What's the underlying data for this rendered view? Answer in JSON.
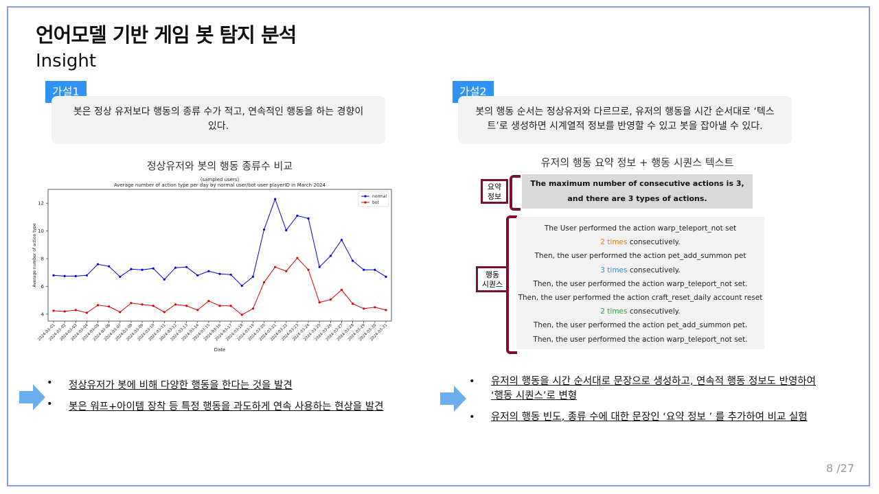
{
  "title": "언어모델 기반 게임 봇 탐지 분석",
  "subtitle": "Insight",
  "left": {
    "tag": "가설1",
    "hypothesis_line1": "봇은 정상 유저보다 행동의 종류 수가 적고, 연속적인 행동을 하는 경향이",
    "hypothesis_line2": "있다.",
    "section_title": "정상유저와 봇의 행동 종류수 비교",
    "bullets": [
      "정상유저가 봇에 비해 다양한 행동을 한다는 것을 발견",
      "봇은 워프+아이템 장착 등 특정 행동을 과도하게 연속 사용하는 현상을 발견"
    ]
  },
  "right": {
    "tag": "가설2",
    "hypothesis_line1": "봇의 행동 순서는 정상유저와 다르므로, 유저의 행동을 시간 순서대로 ‘텍스",
    "hypothesis_line2": "트’로 생성하면 시계열적 정보를 반영할 수 있고 봇을 잡아낼 수 있다.",
    "section_title": "유저의 행동 요약 정보 + 행동 시퀀스 텍스트",
    "summary_label_1": "요약",
    "summary_label_2": "정보",
    "summary_line1": "The maximum number of consecutive actions is 3,",
    "summary_line2": "and there are 3 types of actions.",
    "sequence_label_1": "행동",
    "sequence_label_2": "시퀀스",
    "sequence": {
      "l1": "The User performed the action warp_teleport_not set",
      "l2_num": "2 times",
      "l2_rest": " consecutively.",
      "l3": "Then, the user performed the action pet_add_summon pet",
      "l4_num": "3 times",
      "l4_rest": " consecutively.",
      "l5": "Then, the user performed the action warp_teleport_not set.",
      "l6": "Then, the user performed the action craft_reset_daily account reset",
      "l7_num": "2 times",
      "l7_rest": " consecutively.",
      "l8": "Then, the user performed the action pet_add_summon pet.",
      "l9": "Then, the user performed the action warp_teleport_not set."
    },
    "bullet1_line1": "유저의 행동을 시간 순서대로 문장으로 생성하고, 연속적 행동 정보도 반영하여",
    "bullet1_line2": "‘행동 시퀀스’로 변형",
    "bullet2": "유저의 행동 빈도, 종류 수에 대한 문장인 ‘요약 정보 ’ 를 추가하여 비교 실험"
  },
  "page": "8 /27",
  "colors": {
    "normal": "#0000dd",
    "bot": "#dd0000",
    "accent": "#2f93f3",
    "bracket": "#7a1030"
  },
  "chart_data": {
    "type": "line",
    "title": "(sampled users)",
    "subtitle": "Average number of action type per day by normal user/bot user playerID in March 2024",
    "xlabel": "Date",
    "ylabel": "Average number of action type",
    "ylim": [
      3.5,
      13
    ],
    "yticks": [
      4,
      6,
      8,
      10,
      12
    ],
    "legend": "top-right",
    "x": [
      "2024-03-01",
      "2024-03-02",
      "2024-03-03",
      "2024-03-04",
      "2024-03-05",
      "2024-03-06",
      "2024-03-07",
      "2024-03-08",
      "2024-03-09",
      "2024-03-10",
      "2024-03-11",
      "2024-03-12",
      "2024-03-13",
      "2024-03-14",
      "2024-03-15",
      "2024-03-16",
      "2024-03-17",
      "2024-03-18",
      "2024-03-19",
      "2024-03-20",
      "2024-03-21",
      "2024-03-22",
      "2024-03-23",
      "2024-03-24",
      "2024-03-25",
      "2024-03-26",
      "2024-03-27",
      "2024-03-28",
      "2024-03-29",
      "2024-03-30",
      "2024-03-31"
    ],
    "series": [
      {
        "name": "normal",
        "values": [
          6.8,
          6.75,
          6.75,
          6.8,
          7.6,
          7.45,
          6.7,
          7.25,
          7.2,
          7.3,
          6.5,
          7.35,
          7.4,
          6.8,
          7.1,
          6.9,
          6.85,
          6.05,
          6.7,
          10.1,
          12.3,
          10.05,
          11.1,
          10.9,
          7.4,
          8.2,
          9.35,
          7.85,
          7.2,
          7.2,
          6.7
        ]
      },
      {
        "name": "bot",
        "values": [
          4.25,
          4.2,
          4.3,
          4.1,
          4.65,
          4.55,
          4.15,
          4.8,
          4.7,
          4.6,
          4.15,
          4.7,
          4.6,
          4.3,
          4.95,
          4.6,
          4.6,
          3.95,
          4.4,
          6.3,
          7.4,
          7.1,
          8.05,
          7.2,
          4.85,
          5.05,
          5.75,
          4.75,
          4.4,
          4.5,
          4.3
        ]
      }
    ]
  }
}
